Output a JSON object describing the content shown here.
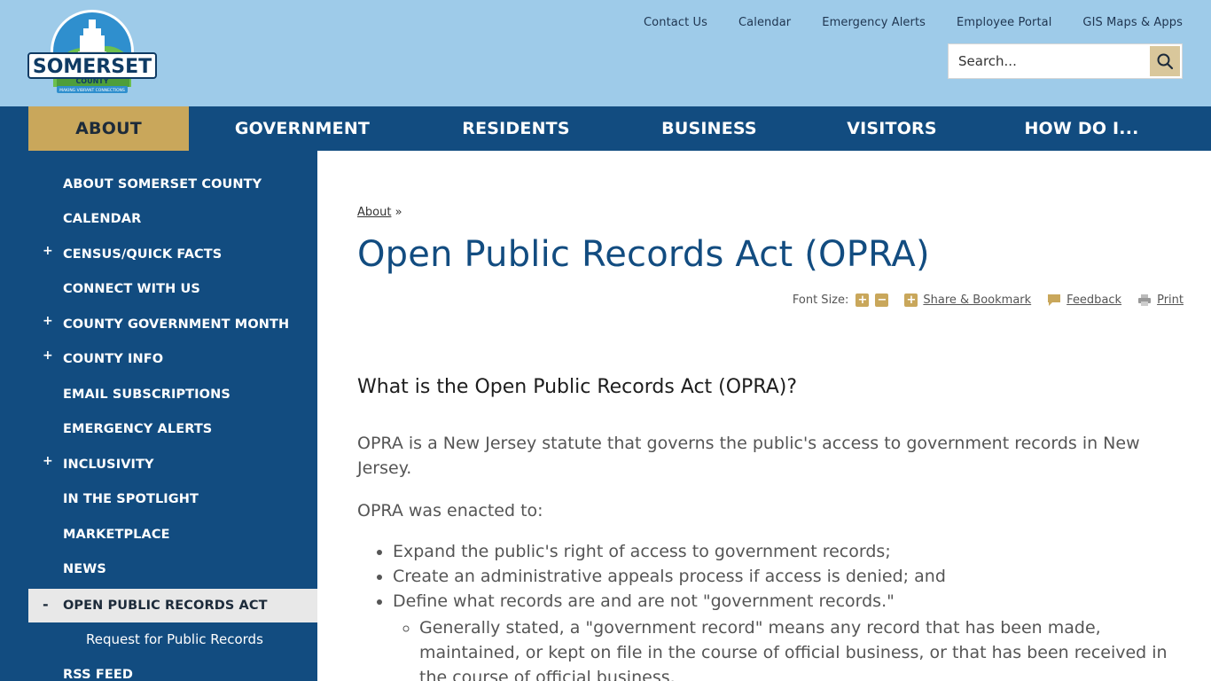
{
  "header": {
    "logo_text_main": "SOMERSET",
    "logo_text_sub": "COUNTY",
    "logo_tagline": "MAKING VIBRANT CONNECTIONS",
    "utility_links": [
      "Contact Us",
      "Calendar",
      "Emergency Alerts",
      "Employee Portal",
      "GIS Maps & Apps"
    ],
    "search_placeholder": "Search..."
  },
  "main_nav": {
    "items": [
      "ABOUT",
      "GOVERNMENT",
      "RESIDENTS",
      "BUSINESS",
      "VISITORS",
      "HOW DO I..."
    ],
    "active": "ABOUT"
  },
  "sidebar": {
    "items": [
      {
        "label": "ABOUT SOMERSET COUNTY",
        "expand": ""
      },
      {
        "label": "CALENDAR",
        "expand": ""
      },
      {
        "label": "CENSUS/QUICK FACTS",
        "expand": "+"
      },
      {
        "label": "CONNECT WITH US",
        "expand": ""
      },
      {
        "label": "COUNTY GOVERNMENT MONTH",
        "expand": "+"
      },
      {
        "label": "COUNTY INFO",
        "expand": "+"
      },
      {
        "label": "EMAIL SUBSCRIPTIONS",
        "expand": ""
      },
      {
        "label": "EMERGENCY ALERTS",
        "expand": ""
      },
      {
        "label": "INCLUSIVITY",
        "expand": "+"
      },
      {
        "label": "IN THE SPOTLIGHT",
        "expand": ""
      },
      {
        "label": "MARKETPLACE",
        "expand": ""
      },
      {
        "label": "NEWS",
        "expand": ""
      },
      {
        "label": "OPEN PUBLIC RECORDS ACT",
        "expand": "-"
      },
      {
        "label": "RSS FEED",
        "expand": ""
      }
    ],
    "sub_item": "Request for Public Records"
  },
  "content": {
    "breadcrumb_link": "About",
    "breadcrumb_sep": " »",
    "title": "Open Public Records Act (OPRA)",
    "tools": {
      "font_size_label": "Font Size:",
      "share_label": "Share & Bookmark",
      "feedback_label": "Feedback",
      "print_label": "Print"
    },
    "heading": "What is the Open Public Records Act (OPRA)?",
    "para1": "OPRA is a New Jersey statute that governs the public's access to government records in New Jersey.",
    "para2": "OPRA was enacted to:",
    "bullets": [
      "Expand the public's right of access to government records;",
      "Create an administrative appeals process if access is denied; and",
      "Define what records are and are not \"government records.\""
    ],
    "sub_bullet": "Generally stated, a \"government record\" means any record that has been made, maintained, or kept on file in the course of official business, or that has been received in the course of official business."
  },
  "colors": {
    "header_bg": "#9ecbe9",
    "nav_bg": "#124c80",
    "accent_gold": "#c9a75b",
    "title_blue": "#124c80"
  }
}
